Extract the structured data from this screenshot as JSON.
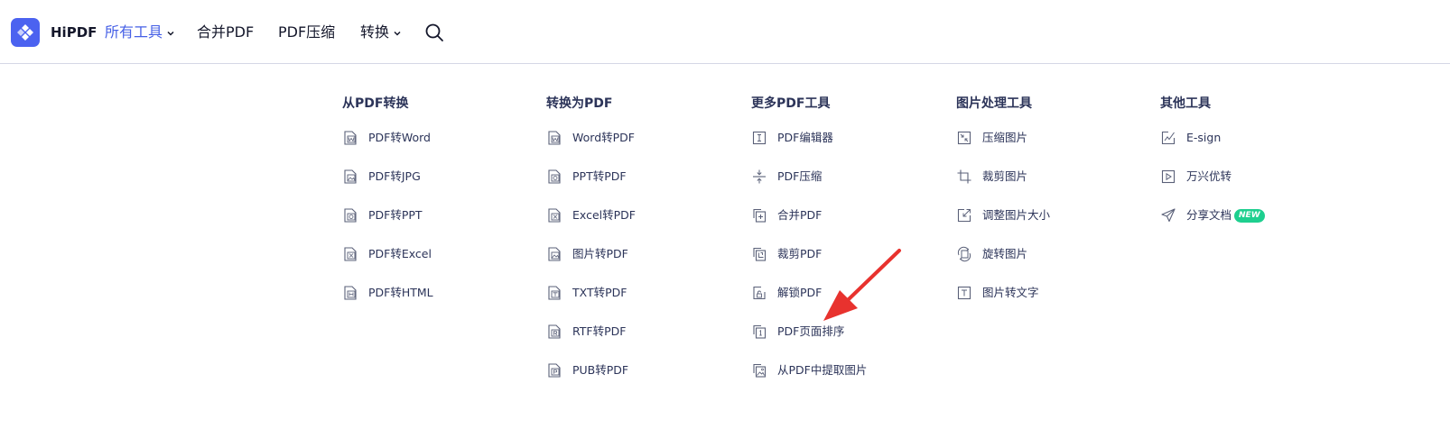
{
  "header": {
    "brand": "HiPDF",
    "nav": [
      {
        "label": "所有工具",
        "active": true,
        "has_dropdown": true
      },
      {
        "label": "合并PDF",
        "active": false,
        "has_dropdown": false
      },
      {
        "label": "PDF压缩",
        "active": false,
        "has_dropdown": false
      },
      {
        "label": "转换",
        "active": false,
        "has_dropdown": true
      }
    ],
    "search_icon": "search-icon"
  },
  "columns": [
    {
      "title": "从PDF转换",
      "items": [
        {
          "label": "PDF转Word",
          "icon": "word-file-icon"
        },
        {
          "label": "PDF转JPG",
          "icon": "image-file-icon"
        },
        {
          "label": "PDF转PPT",
          "icon": "ppt-file-icon"
        },
        {
          "label": "PDF转Excel",
          "icon": "excel-file-icon"
        },
        {
          "label": "PDF转HTML",
          "icon": "html-file-icon"
        }
      ]
    },
    {
      "title": "转换为PDF",
      "items": [
        {
          "label": "Word转PDF",
          "icon": "word-file-icon"
        },
        {
          "label": "PPT转PDF",
          "icon": "ppt-file-icon"
        },
        {
          "label": "Excel转PDF",
          "icon": "excel-file-icon"
        },
        {
          "label": "图片转PDF",
          "icon": "image-file-icon"
        },
        {
          "label": "TXT转PDF",
          "icon": "txt-file-icon"
        },
        {
          "label": "RTF转PDF",
          "icon": "rtf-file-icon"
        },
        {
          "label": "PUB转PDF",
          "icon": "pub-file-icon"
        }
      ]
    },
    {
      "title": "更多PDF工具",
      "items": [
        {
          "label": "PDF编辑器",
          "icon": "text-cursor-icon"
        },
        {
          "label": "PDF压缩",
          "icon": "compress-icon"
        },
        {
          "label": "合并PDF",
          "icon": "merge-icon"
        },
        {
          "label": "裁剪PDF",
          "icon": "crop-file-icon"
        },
        {
          "label": "解锁PDF",
          "icon": "unlock-icon"
        },
        {
          "label": "PDF页面排序",
          "icon": "page-order-icon"
        },
        {
          "label": "从PDF中提取图片",
          "icon": "extract-image-icon"
        }
      ]
    },
    {
      "title": "图片处理工具",
      "items": [
        {
          "label": "压缩图片",
          "icon": "compress-image-icon"
        },
        {
          "label": "裁剪图片",
          "icon": "crop-icon"
        },
        {
          "label": "调整图片大小",
          "icon": "resize-icon"
        },
        {
          "label": "旋转图片",
          "icon": "rotate-icon"
        },
        {
          "label": "图片转文字",
          "icon": "text-icon"
        }
      ]
    },
    {
      "title": "其他工具",
      "items": [
        {
          "label": "E-sign",
          "icon": "signature-icon"
        },
        {
          "label": "万兴优转",
          "icon": "play-icon"
        },
        {
          "label": "分享文档",
          "icon": "send-icon",
          "badge": "NEW"
        }
      ]
    }
  ],
  "annotation": {
    "type": "arrow",
    "color": "#e8322e",
    "points_to": "PDF页面排序"
  },
  "colors": {
    "accent": "#4660e6",
    "logo": "#4b62f0",
    "text": "#2c3459",
    "badge": "#1ecf8f",
    "arrow": "#e8322e"
  }
}
